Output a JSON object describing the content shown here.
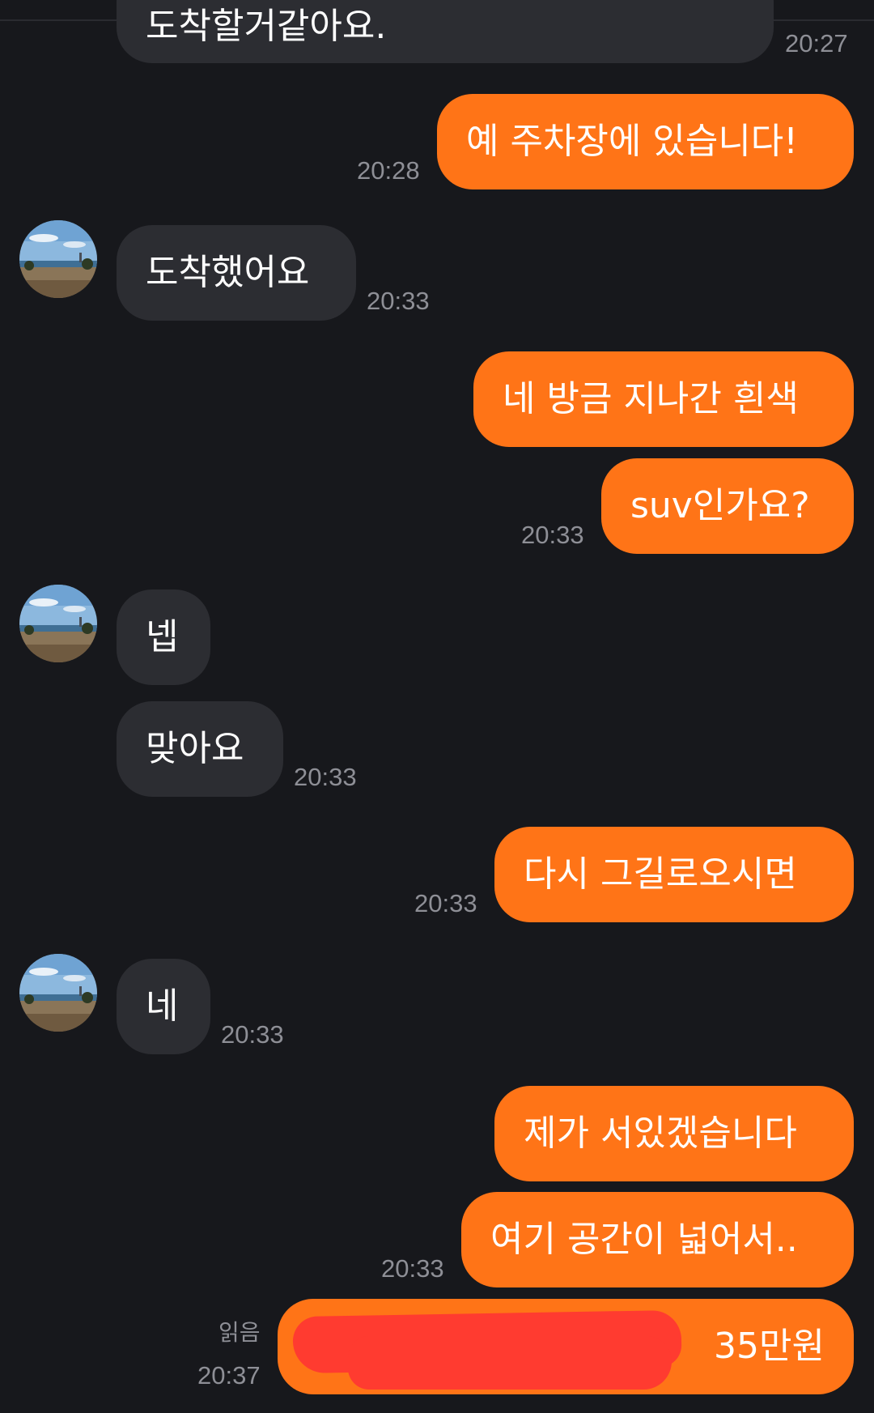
{
  "messages": {
    "m0": {
      "text": "도착할거같아요.",
      "time": "20:27"
    },
    "m1": {
      "text": "예 주차장에 있습니다!",
      "time": "20:28"
    },
    "m2": {
      "text": "도착했어요",
      "time": "20:33"
    },
    "m3": {
      "text": "네 방금 지나간 흰색"
    },
    "m4": {
      "text": "suv인가요?",
      "time": "20:33"
    },
    "m5": {
      "text": "넵"
    },
    "m6": {
      "text": "맞아요",
      "time": "20:33"
    },
    "m7": {
      "text": "다시 그길로오시면",
      "time": "20:33"
    },
    "m8": {
      "text": "네",
      "time": "20:33"
    },
    "m9": {
      "text": "제가 서있겠습니다"
    },
    "m10": {
      "text": "여기 공간이 넓어서..",
      "time": "20:33"
    },
    "m11": {
      "text": "35만원",
      "time": "20:37",
      "read_label": "읽음"
    }
  },
  "avatar": {
    "icon": "profile-landscape-photo"
  },
  "colors": {
    "background": "#17181c",
    "incoming_bubble": "#2c2d32",
    "outgoing_bubble": "#ff7417",
    "timestamp": "#8e8f96",
    "redaction": "#ff3b30"
  }
}
